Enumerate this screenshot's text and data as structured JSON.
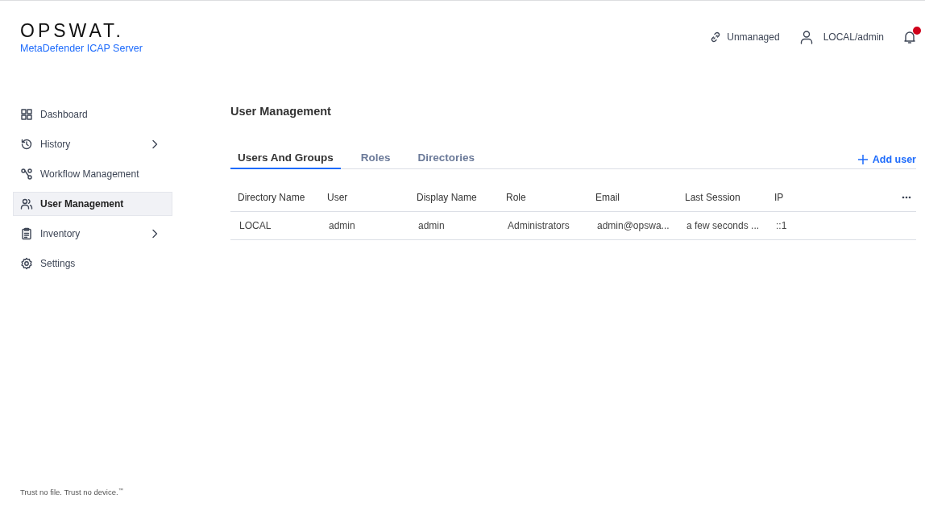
{
  "brand": {
    "logo": "OPSWAT.",
    "product": "MetaDefender ICAP Server"
  },
  "header": {
    "status": "Unmanaged",
    "user": "LOCAL/admin",
    "notifications": {
      "unread": true
    }
  },
  "sidebar": {
    "items": [
      {
        "label": "Dashboard",
        "selected": false,
        "has_submenu": false
      },
      {
        "label": "History",
        "selected": false,
        "has_submenu": true
      },
      {
        "label": "Workflow Management",
        "selected": false,
        "has_submenu": false
      },
      {
        "label": "User Management",
        "selected": true,
        "has_submenu": false
      },
      {
        "label": "Inventory",
        "selected": false,
        "has_submenu": true
      },
      {
        "label": "Settings",
        "selected": false,
        "has_submenu": false
      }
    ],
    "footer": "Trust no file. Trust no device.$^{™}$"
  },
  "page": {
    "title": "User Management",
    "tabs": [
      {
        "label": "Users And Groups",
        "selected": true
      },
      {
        "label": "Roles",
        "selected": false
      },
      {
        "label": "Directories",
        "selected": false
      }
    ],
    "add_button": "Add user",
    "table": {
      "columns": [
        "Directory Name",
        "User",
        "Display Name",
        "Role",
        "Email",
        "Last Session",
        "IP"
      ],
      "rows": [
        [
          "LOCAL",
          "admin",
          "admin",
          "Administrators",
          "admin@opswa...",
          "a few seconds ...",
          "::1"
        ]
      ]
    }
  }
}
